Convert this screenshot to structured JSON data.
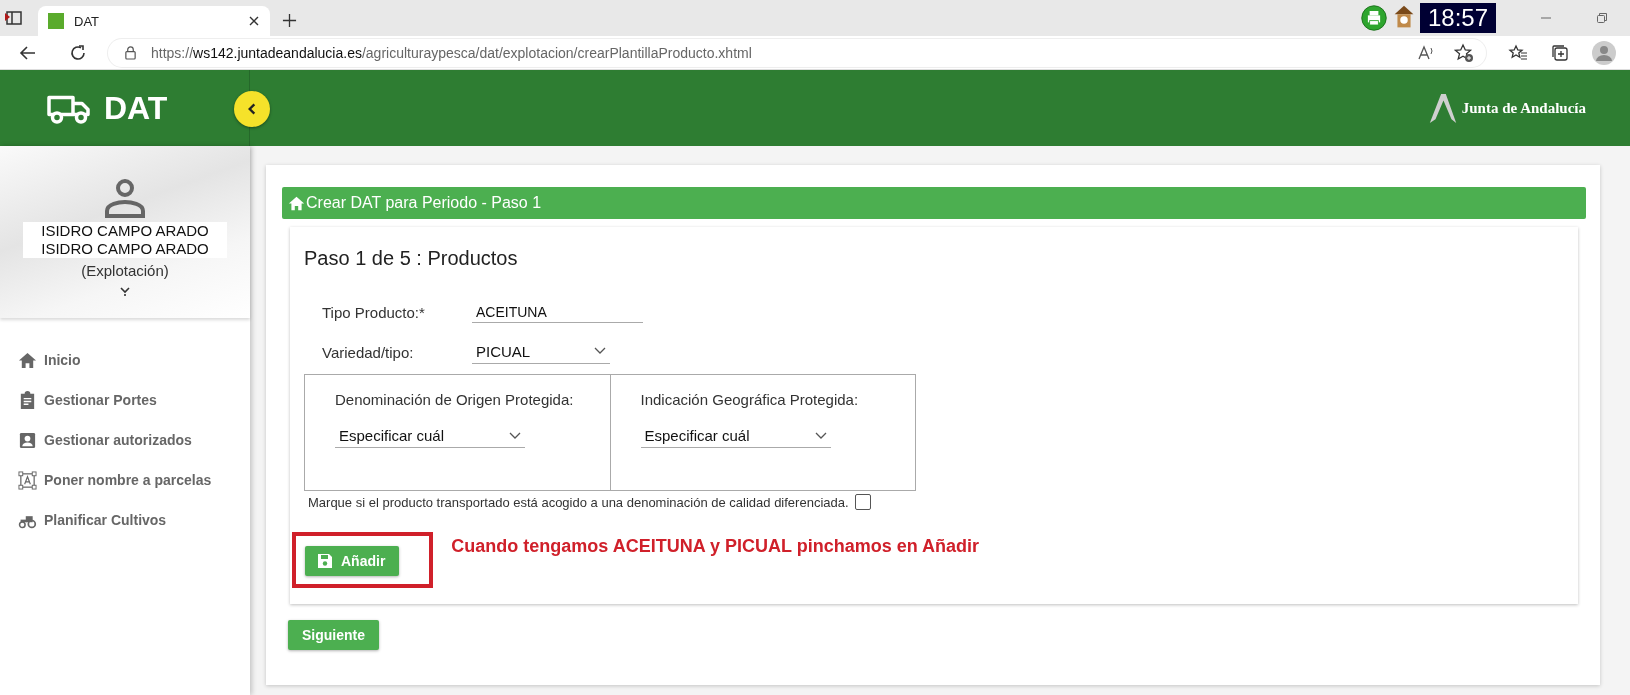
{
  "browser": {
    "tab_title": "DAT",
    "url_scheme": "https://",
    "url_host": "ws142.juntadeandalucia.es",
    "url_path": "/agriculturaypesca/dat/explotacion/crearPlantillaProducto.xhtml",
    "clock": "18:57"
  },
  "header": {
    "app_name": "DAT",
    "brand": "Junta de Andalucía"
  },
  "profile": {
    "name_lines": [
      "ISIDRO CAMPO ARADO",
      "ISIDRO CAMPO ARADO"
    ],
    "role": "(Explotación)"
  },
  "sidebar": {
    "items": [
      {
        "label": "Inicio",
        "kind": "home"
      },
      {
        "label": "Gestionar Portes",
        "kind": "clipboard"
      },
      {
        "label": "Gestionar autorizados",
        "kind": "person"
      },
      {
        "label": "Poner nombre a parcelas",
        "kind": "text-frame"
      },
      {
        "label": "Planificar Cultivos",
        "kind": "tractor"
      }
    ]
  },
  "panel": {
    "title": "Crear DAT para Periodo - Paso 1",
    "step_heading": "Paso 1 de 5 : Productos",
    "fields": [
      {
        "kind": "input",
        "label": "Tipo Producto:",
        "required_mark": "*",
        "value": "ACEITUNA"
      },
      {
        "kind": "dropdown",
        "label": "Variedad/tipo:",
        "value": "PICUAL"
      }
    ],
    "quality_boxes": [
      {
        "label": "Denominación de Origen Protegida:",
        "value": "Especificar cuál"
      },
      {
        "label": "Indicación Geográfica Protegida:",
        "value": "Especificar cuál"
      }
    ],
    "quality_checkbox": {
      "label": "Marque si el producto transportado está acogido a una denominación de calidad diferenciada.",
      "checked": false
    },
    "add_button": "Añadir",
    "annotation": "Cuando tengamos ACEITUNA y PICUAL pinchamos en Añadir",
    "next_button": "Siguiente"
  }
}
